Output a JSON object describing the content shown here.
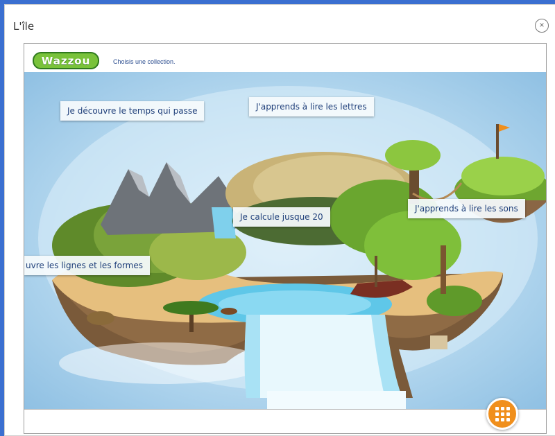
{
  "window": {
    "title": "L'île",
    "close_glyph": "×"
  },
  "app": {
    "logo_text": "Wazzou",
    "subtitle": "Choisis une collection."
  },
  "collections": [
    {
      "label": "Je découvre le temps qui passe"
    },
    {
      "label": "J'apprends à lire les lettres"
    },
    {
      "label": "Je calcule jusque 20"
    },
    {
      "label": "J'apprends à lire les sons"
    },
    {
      "label": "uvre les lignes et les formes"
    }
  ],
  "menu_button": {
    "icon": "grid-icon"
  },
  "colors": {
    "background_blue": "#3b6fd0",
    "label_text": "#1f3f7a",
    "menu_orange": "#f08f1c",
    "logo_green": "#79c23a"
  }
}
